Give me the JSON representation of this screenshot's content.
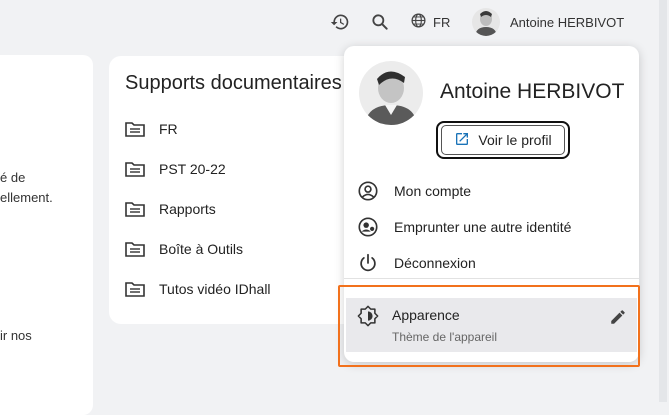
{
  "header": {
    "lang_label": "FR",
    "user_name": "Antoine HERBIVOT",
    "icons": [
      "history-icon",
      "search-icon",
      "globe-icon"
    ]
  },
  "left_card": {
    "fragments": [
      "é de",
      "ellement.",
      "ir nos"
    ]
  },
  "documents": {
    "title": "Supports documentaires",
    "items": [
      {
        "label": "FR"
      },
      {
        "label": "PST 20-22"
      },
      {
        "label": "Rapports"
      },
      {
        "label": "Boîte à Outils"
      },
      {
        "label": "Tutos vidéo IDhall"
      }
    ]
  },
  "user_menu": {
    "name": "Antoine HERBIVOT",
    "profile_button": "Voir le profil",
    "items": [
      {
        "label": "Mon compte",
        "icon": "account-circle-icon"
      },
      {
        "label": "Emprunter une autre identité",
        "icon": "impersonate-icon"
      },
      {
        "label": "Déconnexion",
        "icon": "power-icon"
      }
    ],
    "appearance": {
      "label": "Apparence",
      "sublabel": "Thème de l'appareil",
      "icon": "theme-icon",
      "edit_icon": "pencil-icon"
    }
  },
  "colors": {
    "highlight": "#f2711c",
    "link_blue": "#1a73b8"
  }
}
